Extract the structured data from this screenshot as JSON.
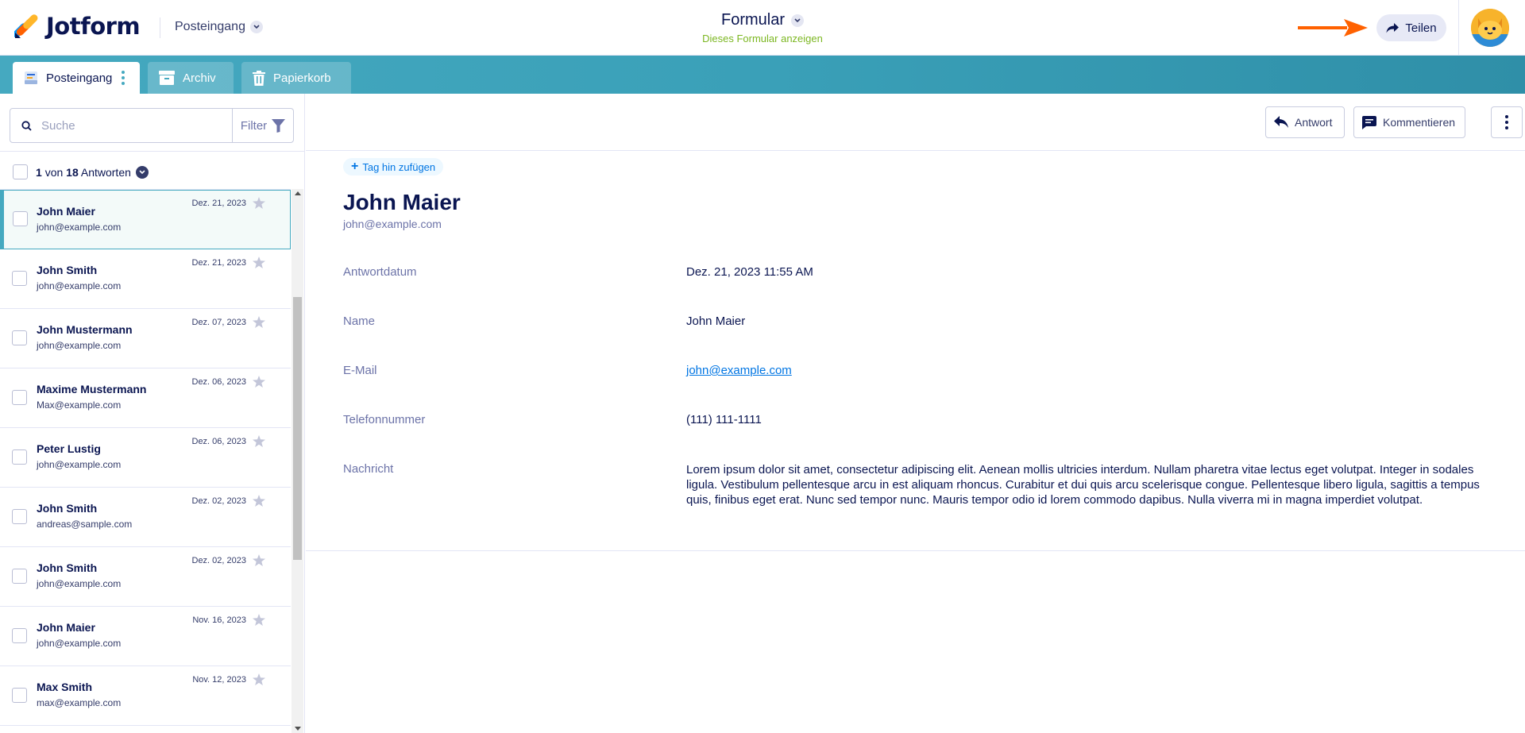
{
  "header": {
    "brand": "Jotform",
    "inbox_switch": "Posteingang",
    "form_title": "Formular",
    "form_link": "Dieses Formular anzeigen",
    "share_label": "Teilen"
  },
  "tabs": [
    {
      "label": "Posteingang",
      "icon": "inbox-icon",
      "active": true
    },
    {
      "label": "Archiv",
      "icon": "archive-icon",
      "active": false
    },
    {
      "label": "Papierkorb",
      "icon": "trash-icon",
      "active": false
    }
  ],
  "search": {
    "placeholder": "Suche",
    "filter_label": "Filter"
  },
  "count": {
    "current": "1",
    "of": "von",
    "total": "18",
    "label": "Antworten"
  },
  "submissions": [
    {
      "name": "John Maier",
      "email": "john@example.com",
      "date": "Dez. 21, 2023",
      "selected": true
    },
    {
      "name": "John Smith",
      "email": "john@example.com",
      "date": "Dez. 21, 2023"
    },
    {
      "name": "John Mustermann",
      "email": "john@example.com",
      "date": "Dez. 07, 2023"
    },
    {
      "name": "Maxime Mustermann",
      "email": "Max@example.com",
      "date": "Dez. 06, 2023"
    },
    {
      "name": "Peter Lustig",
      "email": "john@example.com",
      "date": "Dez. 06, 2023"
    },
    {
      "name": "John Smith",
      "email": "andreas@sample.com",
      "date": "Dez. 02, 2023"
    },
    {
      "name": "John Smith",
      "email": "john@example.com",
      "date": "Dez. 02, 2023"
    },
    {
      "name": "John Maier",
      "email": "john@example.com",
      "date": "Nov. 16, 2023"
    },
    {
      "name": "Max Smith",
      "email": "max@example.com",
      "date": "Nov. 12, 2023"
    }
  ],
  "toolbar": {
    "reply_label": "Antwort",
    "comment_label": "Kommentieren"
  },
  "detail": {
    "tag_add_label": "Tag hin zufügen",
    "name": "John Maier",
    "email": "john@example.com",
    "fields": [
      {
        "label": "Antwortdatum",
        "value": "Dez. 21, 2023 11:55 AM"
      },
      {
        "label": "Name",
        "value": "John Maier"
      },
      {
        "label": "E-Mail",
        "value": "john@example.com"
      },
      {
        "label": "Telefonnummer",
        "value": "(111) 111-1111"
      },
      {
        "label": "Nachricht",
        "value": "Lorem ipsum dolor sit amet, consectetur adipiscing elit. Aenean mollis ultricies interdum. Nullam pharetra vitae lectus eget volutpat. Integer in sodales ligula. Vestibulum pellentesque arcu in est aliquam rhoncus. Curabitur et dui quis arcu scelerisque congue. Pellentesque libero ligula, sagittis a tempus quis, finibus eget erat. Nunc sed tempor nunc. Mauris tempor odio id lorem commodo dapibus. Nulla viverra mi in magna imperdiet volutpat."
      }
    ]
  },
  "colors": {
    "accent_teal": "#45a9c0",
    "navy": "#0a1551",
    "link_blue": "#0075e3",
    "green": "#7cb722",
    "orange_arrow": "#ff6100"
  }
}
